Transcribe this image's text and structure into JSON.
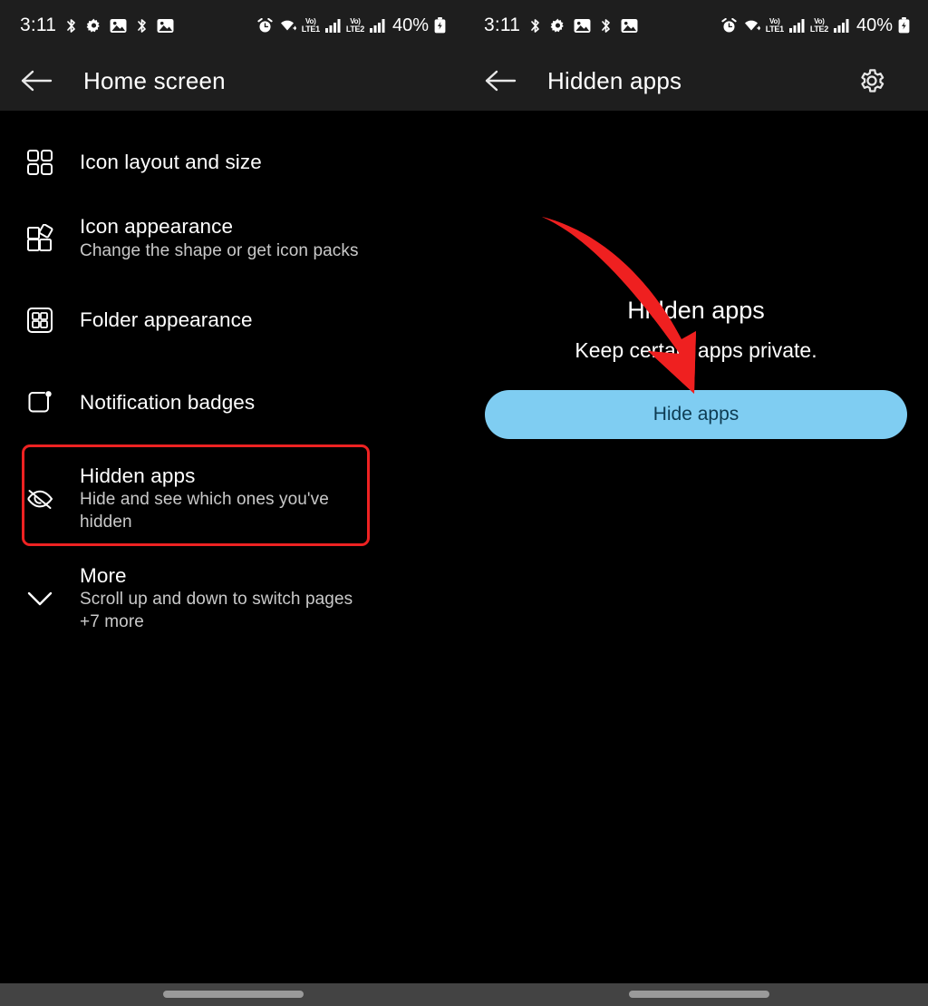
{
  "status_bar": {
    "time": "3:11",
    "battery_percent": "40%",
    "volte1_top": "Vo)",
    "volte1_bottom": "LTE1",
    "volte2_top": "Vo)",
    "volte2_bottom": "LTE2",
    "left_icons": [
      "bluetooth-icon",
      "gear-icon",
      "image-icon",
      "bluetooth-icon",
      "image-icon"
    ],
    "right_icons": [
      "alarm-icon",
      "wifi-icon",
      "volte1-icon",
      "signal-bars-icon",
      "volte2-icon",
      "signal-bars-icon",
      "battery-charging-icon"
    ]
  },
  "left_panel": {
    "header": {
      "back_label": "back-arrow",
      "title": "Home screen"
    },
    "items": [
      {
        "icon": "grid-2x2-icon",
        "title": "Icon layout and size",
        "subtitle": "",
        "extra": ""
      },
      {
        "icon": "icon-shape-icon",
        "title": "Icon appearance",
        "subtitle": "Change the shape or get icon packs",
        "extra": ""
      },
      {
        "icon": "folder-grid-icon",
        "title": "Folder appearance",
        "subtitle": "",
        "extra": ""
      },
      {
        "icon": "badge-square-icon",
        "title": "Notification badges",
        "subtitle": "",
        "extra": ""
      },
      {
        "icon": "eye-off-icon",
        "title": "Hidden apps",
        "subtitle": "Hide and see which ones you've hidden",
        "extra": ""
      },
      {
        "icon": "chevron-down-icon",
        "title": "More",
        "subtitle": "Scroll up and down to switch pages",
        "extra": "+7 more"
      }
    ],
    "highlighted_item_index": 4
  },
  "right_panel": {
    "header": {
      "back_label": "back-arrow",
      "title": "Hidden apps",
      "settings_label": "gear-icon"
    },
    "heading": "Hidden apps",
    "subheading": "Keep certain apps private.",
    "hide_apps_button": "Hide apps",
    "annotation": {
      "type": "red-curved-arrow",
      "points_to": "hide-apps-button"
    }
  },
  "colors": {
    "background": "#000000",
    "header_background": "#1e1e1e",
    "primary_text": "#ffffff",
    "secondary_text": "#c9c9c9",
    "accent_button": "#7fcdf2",
    "accent_button_text": "#0d3b52",
    "annotation_red": "#ee2222",
    "navbar": "#434343",
    "nav_pill": "#9a9a9a"
  }
}
